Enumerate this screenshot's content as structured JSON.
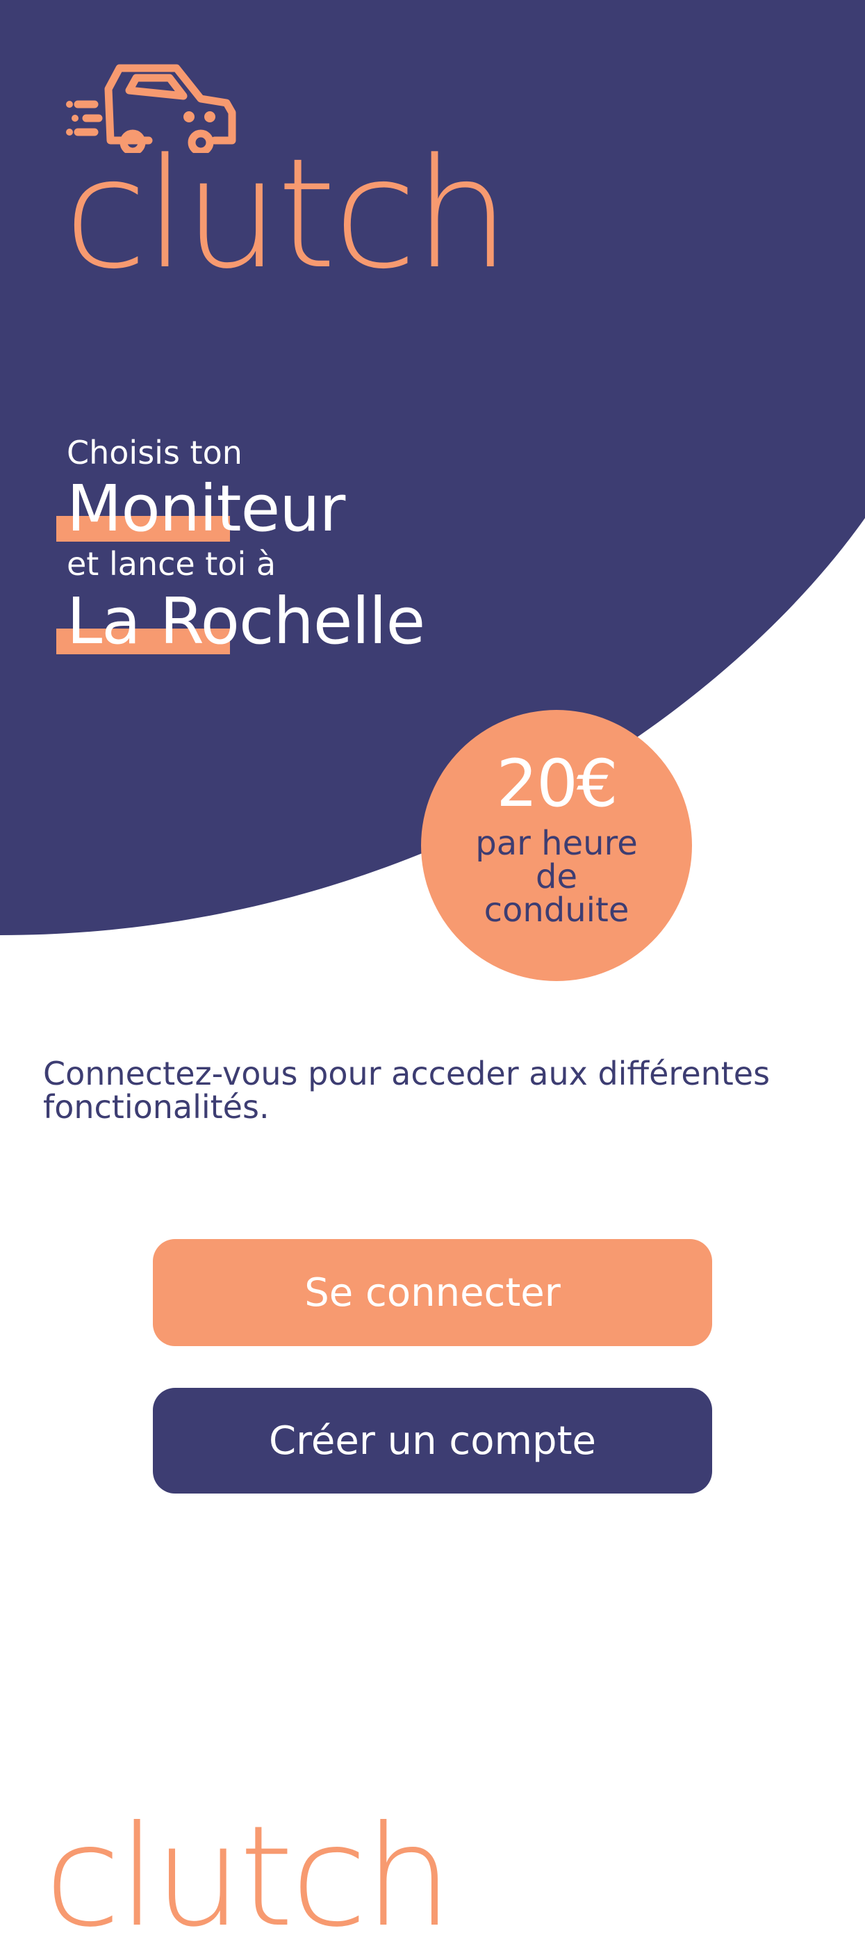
{
  "theme": {
    "primary": "#3d3d72",
    "accent": "#f79a70",
    "background": "#ffffff"
  },
  "header": {
    "logo_icon": "car-speed-icon",
    "brand": "clutch"
  },
  "hero": {
    "line1": "Choisis ton",
    "line2": "Moniteur",
    "line3": "et lance toi à",
    "line4": "La Rochelle"
  },
  "price_badge": {
    "amount": "20€",
    "caption": "par heure\nde\nconduite"
  },
  "intro": {
    "text": "Connectez-vous pour acceder aux différentes fonctionalités."
  },
  "actions": {
    "login_label": "Se connecter",
    "signup_label": "Créer un compte"
  },
  "footer": {
    "brand": "clutch"
  }
}
